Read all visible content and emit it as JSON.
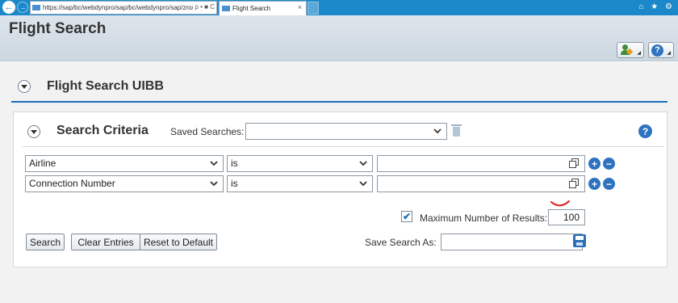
{
  "browser": {
    "url": "https://sap/bc/webdynpro/sap/bc/webdynpro/sap/zro/sap/zo",
    "url_tools": "ρ • ■ C",
    "tab_title": "Flight Search",
    "tab_close": "×",
    "nav_back": "←",
    "nav_forward": "→",
    "right_icons": "⌂ ★ ⚙",
    "accent": "#1b89c9"
  },
  "header": {
    "title": "Flight Search",
    "personalize_icon": "user-settings-icon",
    "help_icon": "help-icon",
    "help_glyph": "?"
  },
  "uibb": {
    "title": "Flight Search UIBB"
  },
  "search_criteria": {
    "title": "Search Criteria",
    "saved_searches_label": "Saved Searches:",
    "saved_searches_value": "",
    "help_glyph": "?",
    "rows": [
      {
        "field": "Airline",
        "operator": "is",
        "value": ""
      },
      {
        "field": "Connection Number",
        "operator": "is",
        "value": ""
      }
    ],
    "add_glyph": "+",
    "remove_glyph": "−",
    "max_results_checked": true,
    "max_results_check_glyph": "✔",
    "max_results_label": "Maximum Number of Results:",
    "max_results_value": "100",
    "buttons": {
      "search": "Search",
      "clear": "Clear Entries",
      "reset": "Reset to Default"
    },
    "save_search_label": "Save Search As:",
    "save_search_value": ""
  },
  "colors": {
    "primary_blue": "#2f72c0",
    "section_line": "#1a6fb5",
    "annotation_red": "#e03030"
  }
}
